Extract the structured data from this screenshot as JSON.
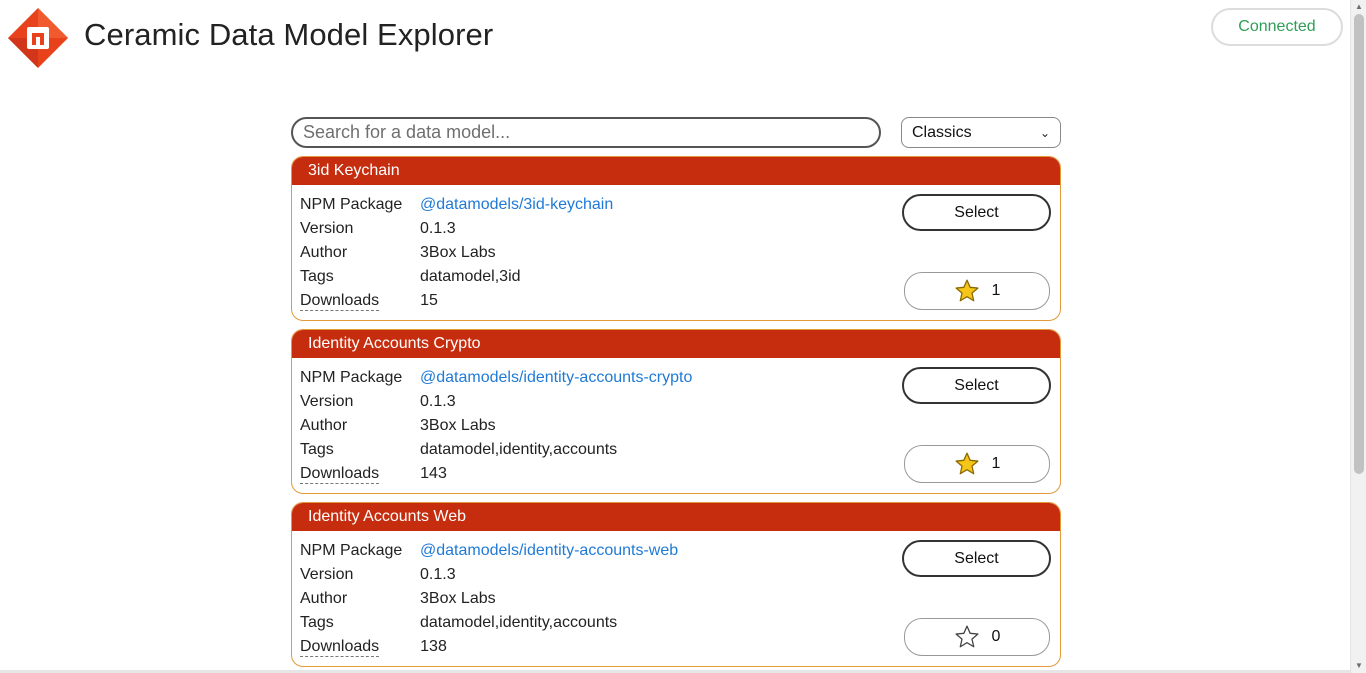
{
  "app": {
    "title": "Ceramic Data Model Explorer",
    "status": "Connected",
    "brand_color": "#e8421c",
    "status_color": "#2e9e55"
  },
  "search": {
    "placeholder": "Search for a data model...",
    "value": ""
  },
  "category": {
    "selected": "Classics"
  },
  "labels": {
    "npm_package": "NPM Package",
    "version": "Version",
    "author": "Author",
    "tags": "Tags",
    "downloads": "Downloads",
    "select": "Select"
  },
  "models": [
    {
      "name": "3id Keychain",
      "package": "@datamodels/3id-keychain",
      "version": "0.1.3",
      "author": "3Box Labs",
      "tags": "datamodel,3id",
      "downloads": "15",
      "stars": "1",
      "starred": true
    },
    {
      "name": "Identity Accounts Crypto",
      "package": "@datamodels/identity-accounts-crypto",
      "version": "0.1.3",
      "author": "3Box Labs",
      "tags": "datamodel,identity,accounts",
      "downloads": "143",
      "stars": "1",
      "starred": true
    },
    {
      "name": "Identity Accounts Web",
      "package": "@datamodels/identity-accounts-web",
      "version": "0.1.3",
      "author": "3Box Labs",
      "tags": "datamodel,identity,accounts",
      "downloads": "138",
      "stars": "0",
      "starred": false
    }
  ],
  "colors": {
    "card_header": "#c62d0e",
    "card_border": "#e39a3c",
    "link": "#1f7ad6",
    "star_fill": "#f5c518"
  },
  "icons": {
    "logo": "ceramic-logo-icon",
    "star_filled": "star-filled-icon",
    "star_empty": "star-outline-icon",
    "dropdown": "chevron-down-icon"
  }
}
